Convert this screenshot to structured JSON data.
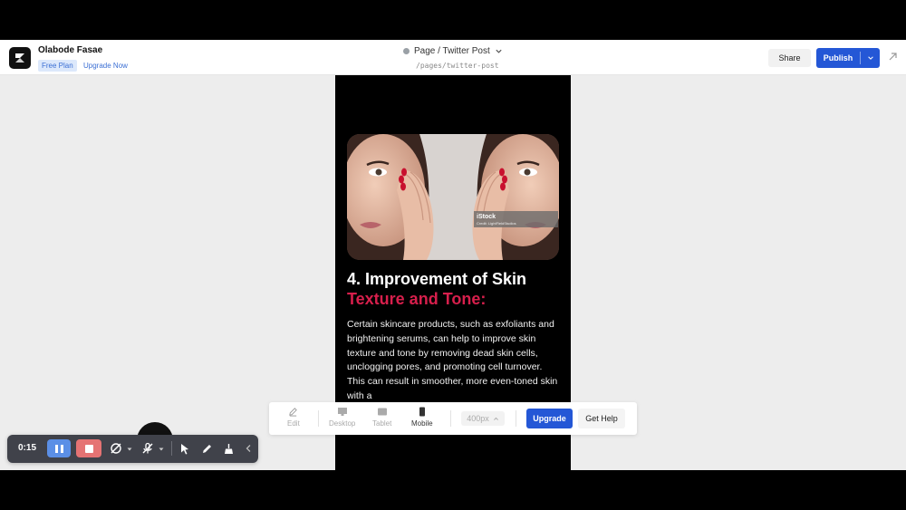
{
  "header": {
    "user_name": "Olabode Fasae",
    "plan_badge": "Free Plan",
    "upgrade_link": "Upgrade Now",
    "page_title": "Page / Twitter Post",
    "page_path": "/pages/twitter-post",
    "share_label": "Share",
    "publish_label": "Publish"
  },
  "content": {
    "hero_watermark": "iStock",
    "hero_watermark_credit": "Credit: LightFieldStudios",
    "heading_line1": "4. Improvement of Skin",
    "heading_line2": "Texture and Tone:",
    "body": "Certain skincare products, such as exfoliants and brightening serums, can help to improve skin texture and tone by removing dead skin cells, unclogging pores, and promoting cell turnover. This can result in smoother, more even-toned skin with a"
  },
  "device_bar": {
    "edit_label": "Edit",
    "desktop_label": "Desktop",
    "tablet_label": "Tablet",
    "mobile_label": "Mobile",
    "width_value": "400px",
    "upgrade_label": "Upgrade",
    "help_label": "Get Help"
  },
  "recorder": {
    "time": "0:15"
  },
  "colors": {
    "accent": "#2457d6",
    "heading_pink": "#d71f4c",
    "canvas_bg": "#ededed"
  }
}
